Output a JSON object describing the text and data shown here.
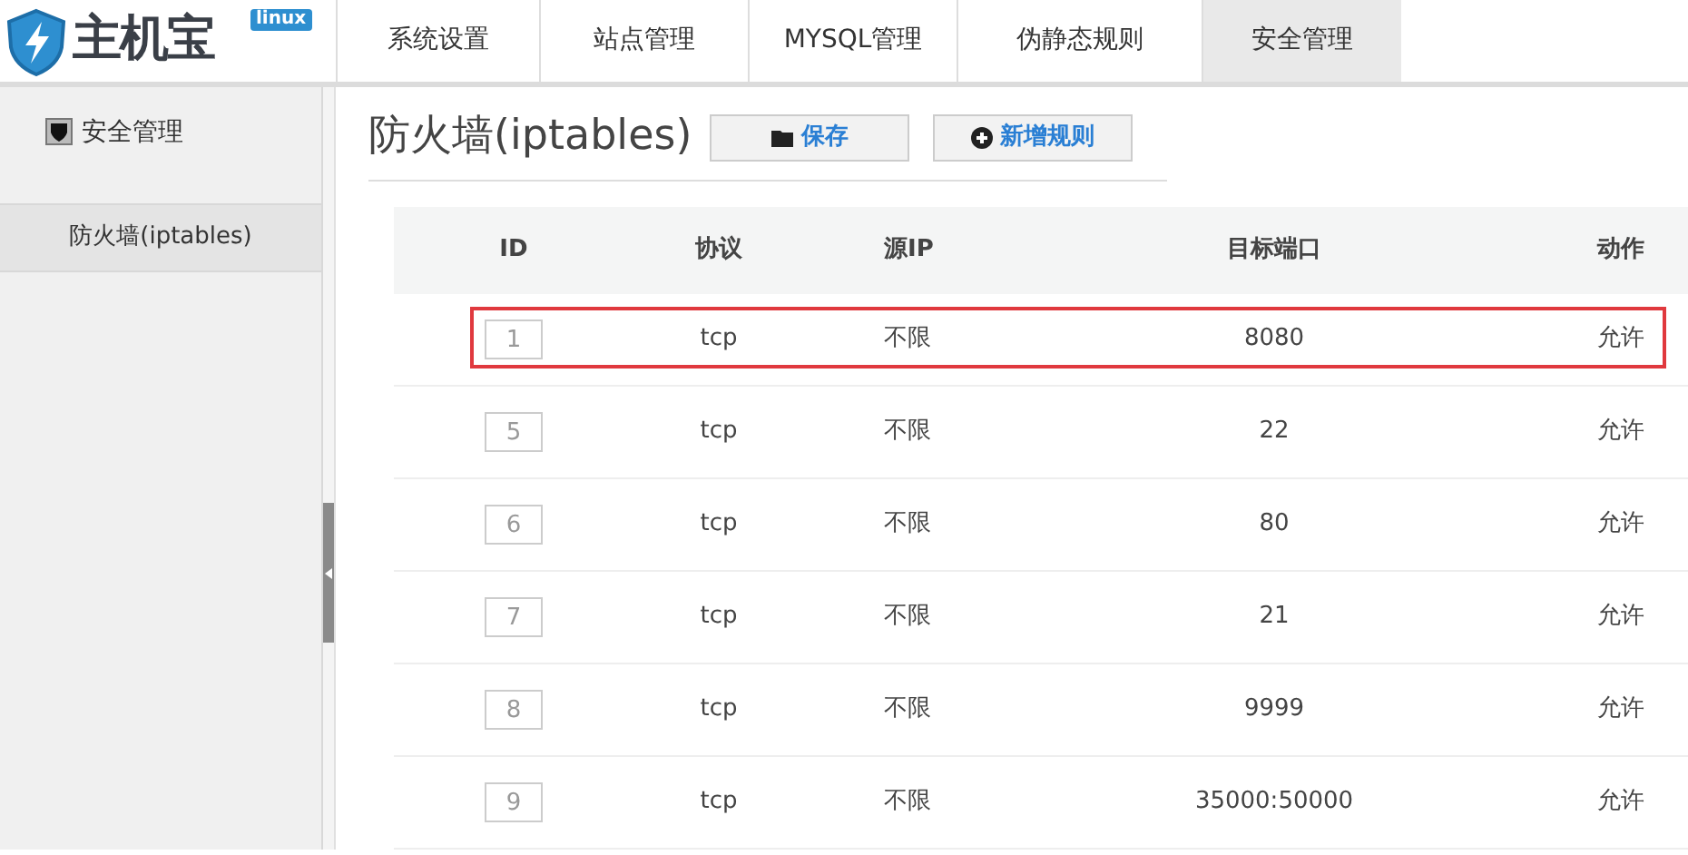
{
  "logo": {
    "name": "主机宝",
    "badge": "linux"
  },
  "nav": [
    {
      "label": "系统设置",
      "selected": false
    },
    {
      "label": "站点管理",
      "selected": false
    },
    {
      "label": "MYSQL管理",
      "selected": false
    },
    {
      "label": "伪静态规则",
      "selected": false
    },
    {
      "label": "安全管理",
      "selected": true
    }
  ],
  "sidebar": {
    "title": "安全管理",
    "items": [
      {
        "label": "防火墙(iptables)",
        "selected": true
      }
    ]
  },
  "page": {
    "title": "防火墙(iptables)",
    "buttons": [
      {
        "label": "保存",
        "kind": "save"
      },
      {
        "label": "新增规则",
        "kind": "add"
      }
    ]
  },
  "table": {
    "columns": [
      "ID",
      "协议",
      "源IP",
      "目标端口",
      "动作"
    ],
    "rows": [
      {
        "id": "1",
        "protocol": "tcp",
        "source": "不限",
        "port": "8080",
        "action": "允许",
        "highlighted": true
      },
      {
        "id": "5",
        "protocol": "tcp",
        "source": "不限",
        "port": "22",
        "action": "允许",
        "highlighted": false
      },
      {
        "id": "6",
        "protocol": "tcp",
        "source": "不限",
        "port": "80",
        "action": "允许",
        "highlighted": false
      },
      {
        "id": "7",
        "protocol": "tcp",
        "source": "不限",
        "port": "21",
        "action": "允许",
        "highlighted": false
      },
      {
        "id": "8",
        "protocol": "tcp",
        "source": "不限",
        "port": "9999",
        "action": "允许",
        "highlighted": false
      },
      {
        "id": "9",
        "protocol": "tcp",
        "source": "不限",
        "port": "35000:50000",
        "action": "允许",
        "highlighted": false
      }
    ]
  }
}
